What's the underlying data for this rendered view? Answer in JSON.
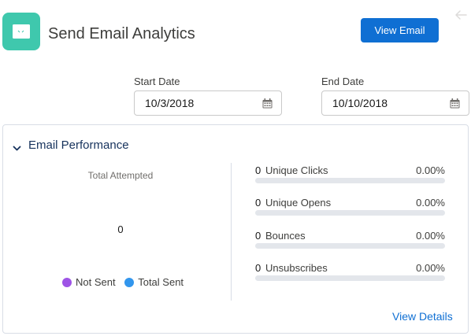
{
  "header": {
    "title": "Send Email Analytics",
    "view_email_label": "View Email",
    "app_icon": "email-analytics-icon",
    "back_icon": "back-arrow-icon"
  },
  "filters": {
    "start_date_label": "Start Date",
    "start_date_value": "10/3/2018",
    "end_date_label": "End Date",
    "end_date_value": "10/10/2018",
    "calendar_icon": "calendar-icon"
  },
  "performance": {
    "title": "Email Performance",
    "total_attempted_label": "Total Attempted",
    "total_attempted_value": "0",
    "legend": [
      {
        "label": "Not Sent",
        "color": "#9e54e6"
      },
      {
        "label": "Total Sent",
        "color": "#3296ed"
      }
    ],
    "metrics": [
      {
        "count": "0",
        "name": "Unique Clicks",
        "percent": "0.00%",
        "fraction": 0
      },
      {
        "count": "0",
        "name": "Unique Opens",
        "percent": "0.00%",
        "fraction": 0
      },
      {
        "count": "0",
        "name": "Bounces",
        "percent": "0.00%",
        "fraction": 0
      },
      {
        "count": "0",
        "name": "Unsubscribes",
        "percent": "0.00%",
        "fraction": 0
      }
    ],
    "view_details_label": "View Details"
  },
  "colors": {
    "brand_blue": "#0f6fd3",
    "icon_teal": "#3fc8ad",
    "title_navy": "#16325c"
  }
}
